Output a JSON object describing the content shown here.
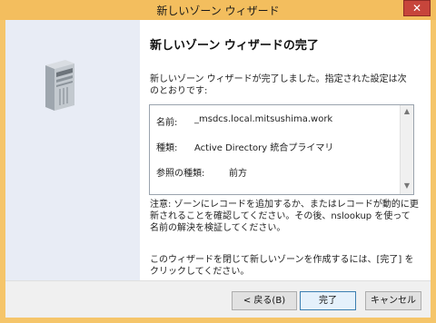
{
  "window": {
    "title": "新しいゾーン ウィザード",
    "close_glyph": "✕"
  },
  "page": {
    "heading": "新しいゾーン ウィザードの完了",
    "description": "新しいゾーン ウィザードが完了しました。指定された設定は次のとおりです:",
    "summary": {
      "rows": [
        {
          "label": "名前:",
          "value": "_msdcs.local.mitsushima.work"
        },
        {
          "label": "種類:",
          "value": "Active Directory 統合プライマリ"
        },
        {
          "label": "参照の種類:",
          "value": "前方"
        }
      ]
    },
    "note": "注意: ゾーンにレコードを追加するか、またはレコードが動的に更新されることを確認してください。その後、nslookup を使って名前の解決を検証してください。",
    "closing": "このウィザードを閉じて新しいゾーンを作成するには、[完了] をクリックしてください。"
  },
  "buttons": {
    "back": "< 戻る(B)",
    "finish": "完了",
    "cancel": "キャンセル"
  },
  "icons": {
    "server": "server-tower-icon"
  },
  "colors": {
    "titlebar": "#f3be5e",
    "close": "#c7453b",
    "left_panel": "#e8ecf5"
  }
}
